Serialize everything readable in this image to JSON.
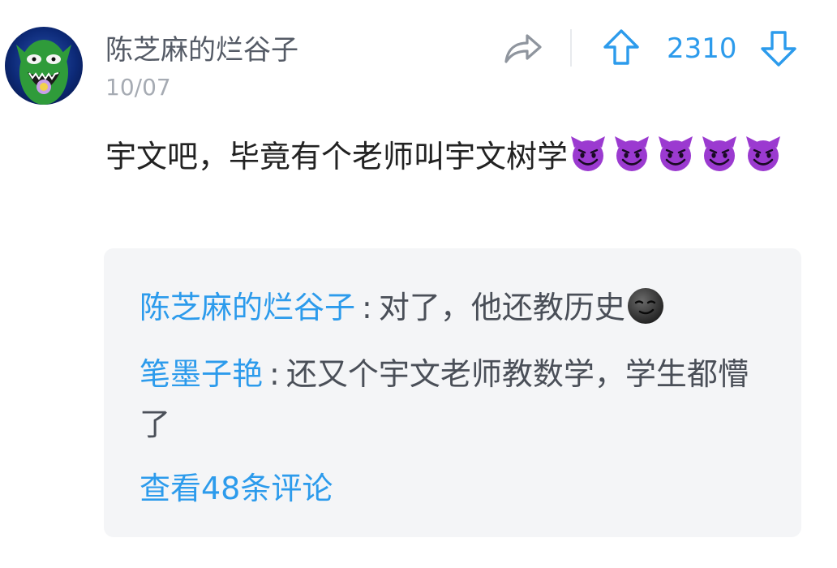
{
  "post": {
    "author": "陈芝麻的烂谷子",
    "date": "10/07",
    "body_text": "宇文吧，毕竟有个老师叫宇文树学",
    "body_emojis": [
      "smiling-devil-emoji",
      "smiling-devil-emoji",
      "smiling-devil-emoji",
      "smiling-devil-emoji",
      "smiling-devil-emoji"
    ]
  },
  "actions": {
    "share_icon": "share-arrow-icon",
    "upvote_icon": "arrow-up-icon",
    "vote_count": "2310",
    "downvote_icon": "arrow-down-icon"
  },
  "replies": [
    {
      "author": "陈芝麻的烂谷子",
      "separator": ":",
      "text": "对了，他还教历史",
      "emoji": "new-moon-face-emoji"
    },
    {
      "author": "笔墨子艳",
      "separator": ":",
      "text": "还又个宇文老师教数学，学生都懵了"
    }
  ],
  "view_more": "查看48条评论",
  "colors": {
    "accent_blue": "#2c9bec",
    "name_gray": "#555b66",
    "date_gray": "#a6abb3",
    "reply_bg": "#f4f5f7",
    "devil_purple": "#9b3ad0"
  }
}
